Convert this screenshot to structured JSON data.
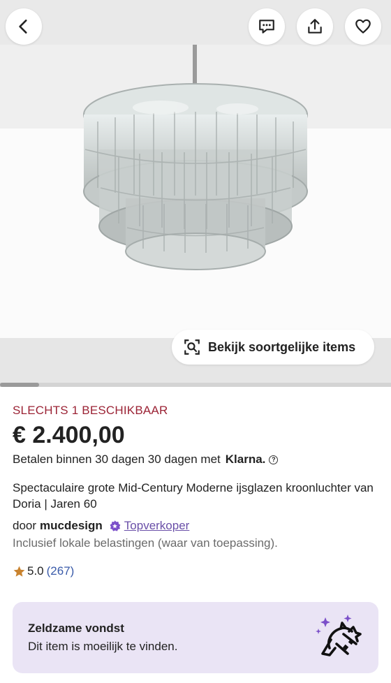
{
  "header": {
    "back_icon": "chevron-left-icon",
    "message_icon": "message-icon",
    "share_icon": "share-icon",
    "favorite_icon": "heart-icon"
  },
  "gallery": {
    "similar_items_label": "Bekijk soortgelijke items",
    "similar_icon": "image-search-icon",
    "progress": 0.1
  },
  "listing": {
    "stock": "SLECHTS 1 BESCHIKBAAR",
    "price": "€ 2.400,00",
    "pay_text": "Betalen binnen 30 dagen 30 dagen met",
    "klarna": "Klarna.",
    "title": "Spectaculaire grote Mid-Century Moderne ijsglazen kroonluchter van Doria | Jaren 60",
    "by": "door",
    "seller": "mucdesign",
    "top_seller": "Topverkoper",
    "tax": "Inclusief lokale belastingen (waar van toepassing).",
    "rating": "5.0",
    "rating_count": "(267)"
  },
  "rare_card": {
    "title": "Zeldzame vondst",
    "subtitle": "Dit item is moeilijk te vinden."
  },
  "colors": {
    "stock": "#9b2335",
    "top_seller": "#6a4fa8",
    "rating_count": "#3a5ba9",
    "star": "#c9832f",
    "rare_card_bg": "#eae4f5",
    "rare_sparkle": "#7b4fc9"
  }
}
